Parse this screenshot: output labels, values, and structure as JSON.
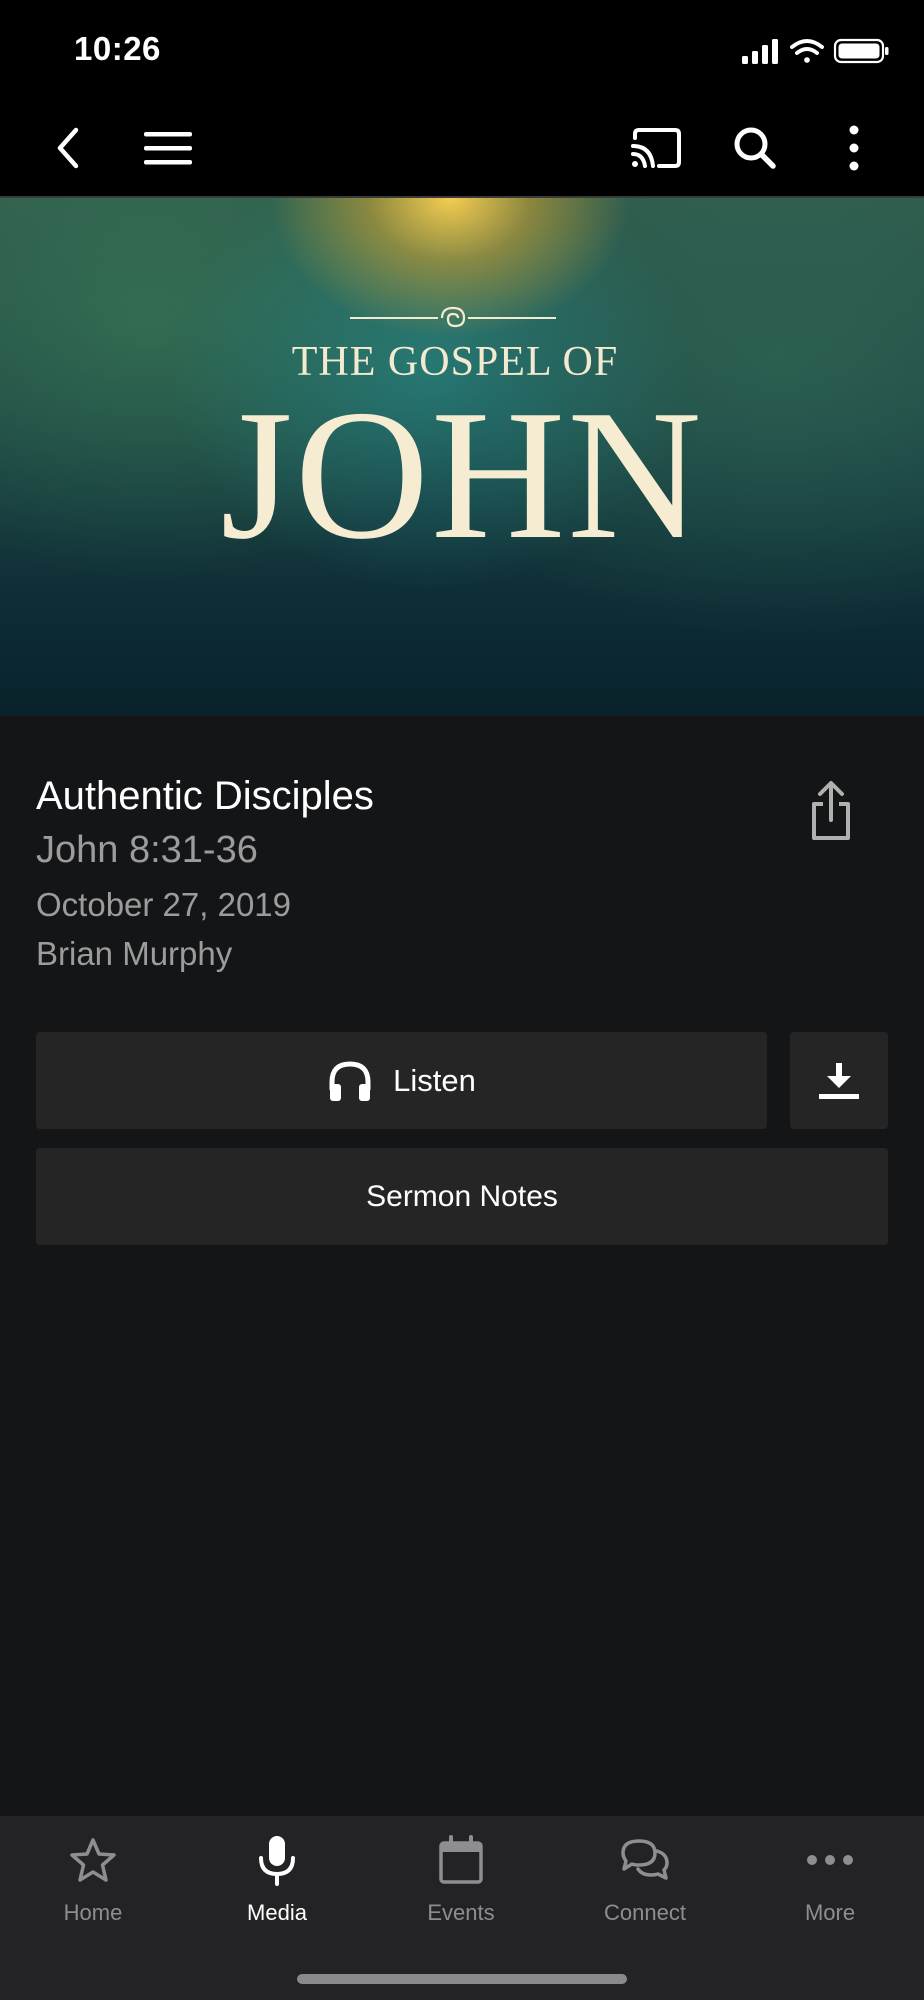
{
  "status_bar": {
    "time": "10:26"
  },
  "nav": {
    "back_icon": "chevron-left-icon",
    "menu_icon": "hamburger-menu-icon",
    "cast_icon": "cast-icon",
    "search_icon": "search-icon",
    "more_icon": "vertical-dots-icon"
  },
  "hero": {
    "subtitle": "THE GOSPEL OF",
    "title": "JOHN"
  },
  "sermon": {
    "title": "Authentic Disciples",
    "scripture": "John 8:31-36",
    "date": "October 27, 2019",
    "speaker": "Brian Murphy"
  },
  "actions": {
    "listen_label": "Listen",
    "sermon_notes_label": "Sermon Notes"
  },
  "tabs": [
    {
      "label": "Home",
      "icon": "star-icon",
      "active": false
    },
    {
      "label": "Media",
      "icon": "microphone-icon",
      "active": true
    },
    {
      "label": "Events",
      "icon": "calendar-icon",
      "active": false
    },
    {
      "label": "Connect",
      "icon": "chat-bubbles-icon",
      "active": false
    },
    {
      "label": "More",
      "icon": "horizontal-dots-icon",
      "active": false
    }
  ],
  "colors": {
    "background": "#141517",
    "button": "#252526",
    "tab_bar": "#232325",
    "muted_text": "#9c9c9c",
    "hero_text": "#f6ecd2"
  }
}
